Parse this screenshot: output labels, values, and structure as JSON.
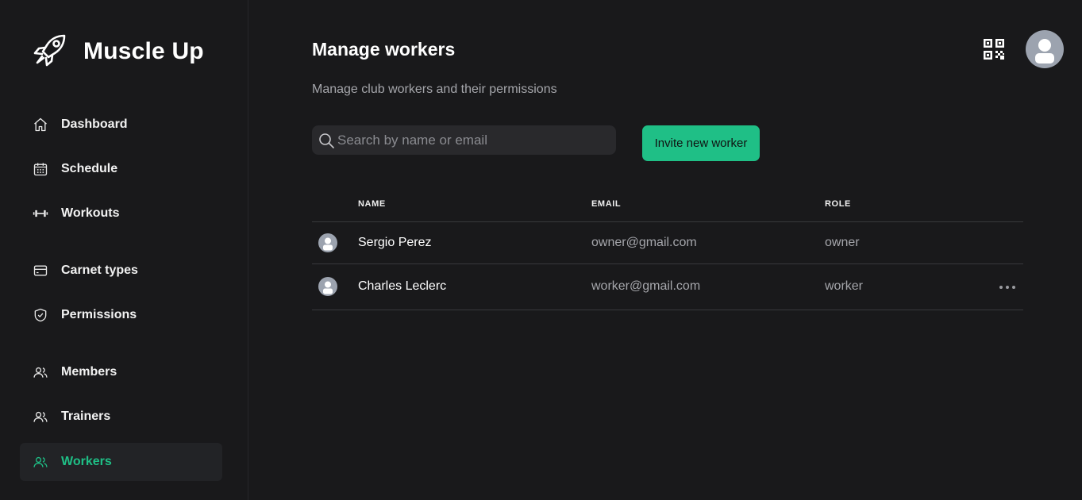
{
  "app": {
    "name": "Muscle Up",
    "logo_icon": "rocket-icon"
  },
  "sidebar": {
    "items": [
      {
        "label": "Dashboard",
        "icon": "home-icon",
        "active": false
      },
      {
        "label": "Schedule",
        "icon": "calendar-icon",
        "active": false
      },
      {
        "label": "Workouts",
        "icon": "dumbbell-icon",
        "active": false
      },
      {
        "label": "Carnet types",
        "icon": "card-icon",
        "active": false
      },
      {
        "label": "Permissions",
        "icon": "shield-icon",
        "active": false
      },
      {
        "label": "Members",
        "icon": "users-icon",
        "active": false
      },
      {
        "label": "Trainers",
        "icon": "users-icon",
        "active": false
      },
      {
        "label": "Workers",
        "icon": "users-icon",
        "active": true
      }
    ]
  },
  "header": {
    "title": "Manage workers",
    "subtitle": "Manage club workers and their permissions",
    "qr_icon": "qr-code-icon",
    "avatar_icon": "user-avatar-icon"
  },
  "toolbar": {
    "search_placeholder": "Search by name or email",
    "search_value": "",
    "invite_label": "Invite new worker"
  },
  "table": {
    "columns": [
      "NAME",
      "EMAIL",
      "ROLE"
    ],
    "rows": [
      {
        "name": "Sergio Perez",
        "email": "owner@gmail.com",
        "role": "owner",
        "has_actions": false
      },
      {
        "name": "Charles Leclerc",
        "email": "worker@gmail.com",
        "role": "worker",
        "has_actions": true
      }
    ]
  },
  "colors": {
    "background": "#19191b",
    "accent": "#1fbf86",
    "muted_text": "#a5a6ab",
    "active_nav_bg": "#222326"
  }
}
